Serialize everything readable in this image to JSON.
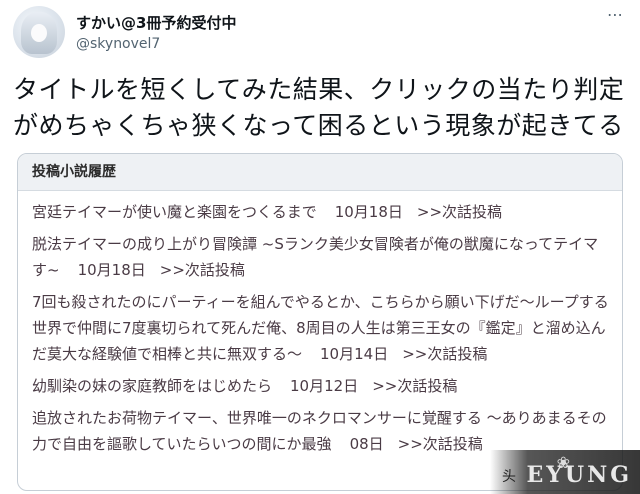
{
  "tweet": {
    "display_name": "すかい@3冊予約受付中",
    "handle": "@skynovel7",
    "more_icon": "more-dots-icon",
    "text": "タイトルを短くしてみた結果、クリックの当たり判定がめちゃくちゃ狭くなって困るという現象が起きてる"
  },
  "panel": {
    "header": "投稿小説履歴",
    "entries": [
      {
        "title": "宮廷テイマーが使い魔と楽園をつくるまで",
        "date": "10月18日",
        "next": ">>次話投稿"
      },
      {
        "title": "脱法テイマーの成り上がり冒険譚 ~Sランク美少女冒険者が俺の獣魔になってテイマす~",
        "date": "10月18日",
        "next": ">>次話投稿"
      },
      {
        "title": "7回も殺されたのにパーティーを組んでやるとか、こちらから願い下げだ～ループする世界で仲間に7度裏切られて死んだ俺、8周目の人生は第三王女の『鑑定』と溜め込んだ莫大な経験値で相棒と共に無双する～",
        "date": "10月14日",
        "next": ">>次話投稿"
      },
      {
        "title": "幼馴染の妹の家庭教師をはじめたら",
        "date": "10月12日",
        "next": ">>次話投稿"
      },
      {
        "title": "追放されたお荷物テイマー、世界唯一のネクロマンサーに覚醒する ～ありあまるその力で自由を謳歌していたらいつの間にか最強",
        "date": "08日",
        "next": ">>次話投稿"
      }
    ]
  },
  "watermark": {
    "prefix": "头",
    "text": "EYUNG",
    "flower": "❀"
  }
}
